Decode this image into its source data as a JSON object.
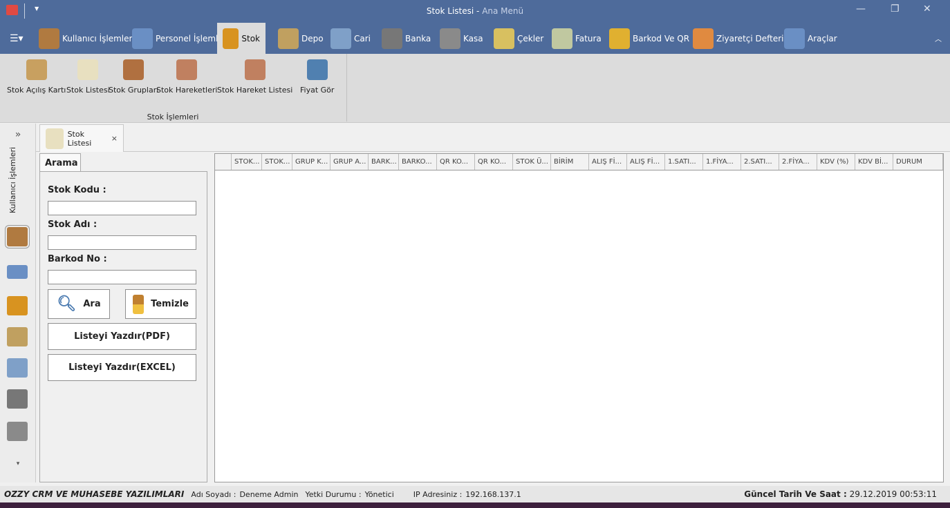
{
  "window": {
    "title": "Stok Listesi",
    "subtitle": "Ana Menü",
    "minimize": "—",
    "restore": "❐",
    "close": "✕"
  },
  "tabs": [
    {
      "label": "Kullanıcı İşlemleri",
      "color": "#b07a40"
    },
    {
      "label": "Personel İşlemleri",
      "color": "#6a8fc4"
    },
    {
      "label": "Stok",
      "color": "#d89320"
    },
    {
      "label": "Depo",
      "color": "#c0a060"
    },
    {
      "label": "Cari",
      "color": "#7fa0c8"
    },
    {
      "label": "Banka",
      "color": "#777777"
    },
    {
      "label": "Kasa",
      "color": "#8a8a8a"
    },
    {
      "label": "Çekler",
      "color": "#d8c060"
    },
    {
      "label": "Fatura",
      "color": "#c0c8a0"
    },
    {
      "label": "Barkod Ve QR",
      "color": "#e0b030"
    },
    {
      "label": "Ziyaretçi Defteri",
      "color": "#e08a40"
    },
    {
      "label": "Araçlar",
      "color": "#6a8fc4"
    }
  ],
  "ribbon": {
    "buttons": [
      {
        "label": "Stok Açılış Kartı"
      },
      {
        "label": "Stok Listesi"
      },
      {
        "label": "Stok Grupları"
      },
      {
        "label": "Stok Hareketleri"
      },
      {
        "label": "Stok Hareket Listesi"
      },
      {
        "label": "Fiyat Gör"
      }
    ],
    "group_label": "Stok İşlemleri"
  },
  "leftnav": {
    "expand": "»",
    "group_label": "Kullanıcı İşlemleri",
    "more": "▾"
  },
  "doc_tab": {
    "label": "Stok Listesi",
    "close": "×"
  },
  "search": {
    "tab": "Arama",
    "stok_kodu_label": "Stok Kodu :",
    "stok_adi_label": "Stok Adı :",
    "barkod_label": "Barkod No :",
    "stok_kodu": "",
    "stok_adi": "",
    "barkod": "",
    "ara": "Ara",
    "temizle": "Temizle",
    "pdf": "Listeyi Yazdır(PDF)",
    "excel": "Listeyi Yazdır(EXCEL)"
  },
  "grid": {
    "columns": [
      "STOK...",
      "STOK...",
      "GRUP K...",
      "GRUP A...",
      "BARK...",
      "BARKO...",
      "QR KO...",
      "QR KO...",
      "STOK Ü...",
      "BİRİM",
      "ALIŞ Fİ...",
      "ALIŞ Fİ...",
      "1.SATI...",
      "1.FİYA...",
      "2.SATI...",
      "2.FİYA...",
      "KDV (%)",
      "KDV Bİ...",
      "DURUM"
    ]
  },
  "status": {
    "brand": "OZZY CRM VE MUHASEBE YAZILIMLARI",
    "name_label": "Adı Soyadı :",
    "name": "Deneme Admin",
    "role_label": "Yetki Durumu :",
    "role": "Yönetici",
    "ip_label": "IP Adresiniz :",
    "ip": "192.168.137.1",
    "datetime_label": "Güncel Tarih Ve Saat :",
    "datetime": "29.12.2019 00:53:11"
  }
}
